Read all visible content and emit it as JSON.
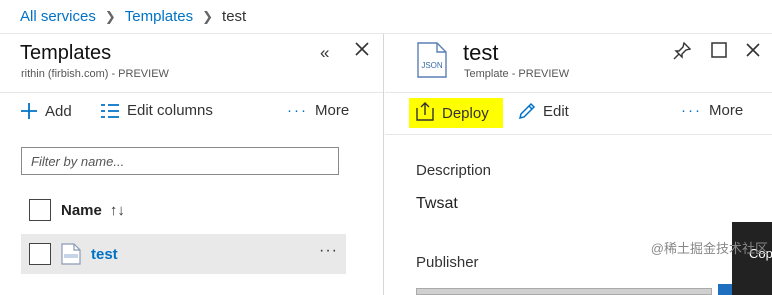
{
  "breadcrumb": {
    "root": "All services",
    "middle": "Templates",
    "current": "test"
  },
  "left": {
    "title": "Templates",
    "subtitle": "rithin (firbish.com) - PREVIEW",
    "toolbar": {
      "add": "Add",
      "edit_columns": "Edit columns",
      "more": "More"
    },
    "filter_placeholder": "Filter by name...",
    "column_header": "Name",
    "rows": [
      {
        "label": "test",
        "icon": "json-file-icon"
      }
    ]
  },
  "right": {
    "title": "test",
    "subtitle": "Template - PREVIEW",
    "file_icon_text": "JSON",
    "toolbar": {
      "deploy": "Deploy",
      "edit": "Edit",
      "more": "More"
    },
    "description_label": "Description",
    "description_value": "Twsat",
    "publisher_label": "Publisher",
    "side_tab_text": "Cop"
  },
  "watermark": "@稀土掘金技术社区",
  "colors": {
    "accent": "#0072c6",
    "highlight": "#ffff00",
    "row_selected": "#e9e9e9"
  }
}
